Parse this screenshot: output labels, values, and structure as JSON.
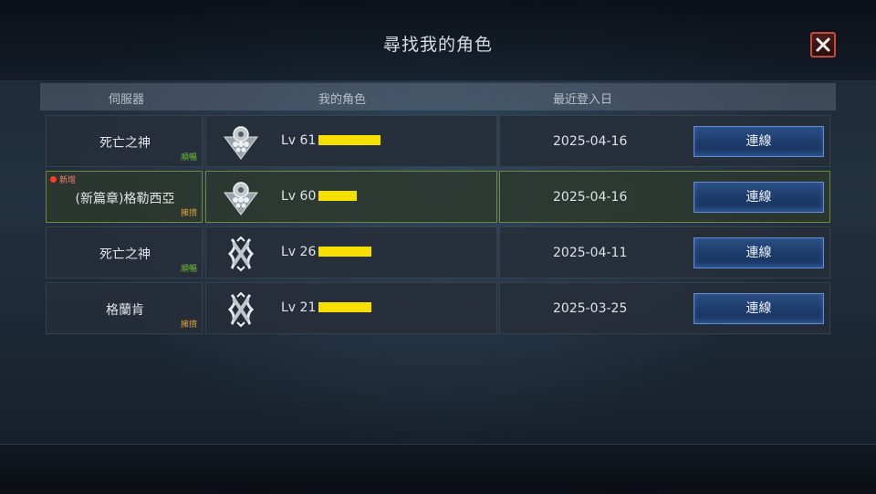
{
  "title": "尋找我的角色",
  "columns": {
    "server": "伺服器",
    "character": "我的角色",
    "last_login": "最近登入日"
  },
  "connect_label": "連線",
  "rows": [
    {
      "server": "死亡之神",
      "status": "順暢",
      "status_color": "#6fbf3a",
      "badge": "",
      "level": "Lv 61",
      "icon": "emblem-icon",
      "date": "2025-04-16"
    },
    {
      "server": "(新篇章)格勒西亞",
      "status": "擁擠",
      "status_color": "#e0a13a",
      "badge": "新增",
      "level": "Lv 60",
      "icon": "emblem-icon",
      "date": "2025-04-16"
    },
    {
      "server": "死亡之神",
      "status": "順暢",
      "status_color": "#6fbf3a",
      "badge": "",
      "level": "Lv 26",
      "icon": "crest-icon",
      "date": "2025-04-11"
    },
    {
      "server": "格蘭肯",
      "status": "擁擠",
      "status_color": "#e0a13a",
      "badge": "",
      "level": "Lv 21",
      "icon": "crest-icon",
      "date": "2025-03-25"
    }
  ]
}
